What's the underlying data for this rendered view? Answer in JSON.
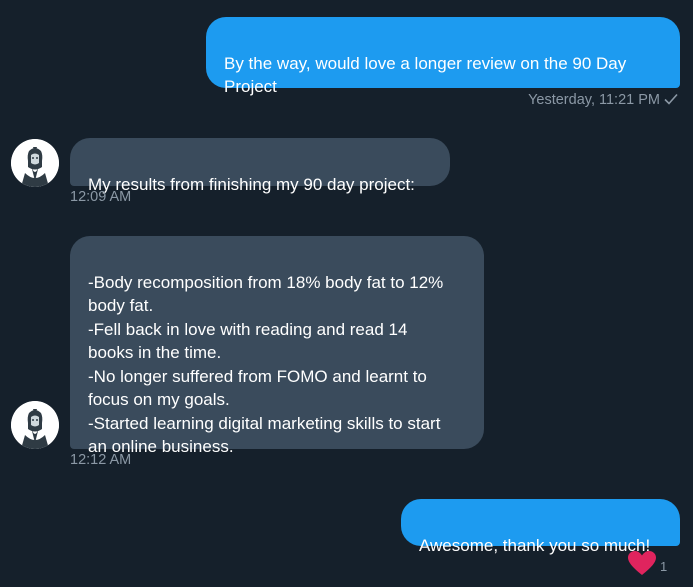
{
  "messages": [
    {
      "id": "m1",
      "direction": "outgoing",
      "text": "By the way, would love a longer review on the 90 Day\nProject",
      "time": "Yesterday, 11:21 PM",
      "status_icon": "check-icon"
    },
    {
      "id": "m2",
      "direction": "incoming",
      "text": "My results from finishing my 90 day project:",
      "time": "12:09 AM"
    },
    {
      "id": "m3",
      "direction": "incoming",
      "text": "-Body recomposition from 18% body fat to 12%\nbody fat.\n-Fell back in love with reading and read 14\nbooks in the time.\n-No longer suffered from FOMO and learnt to\nfocus on my goals.\n-Started learning digital marketing skills to start\nan online business.",
      "time": "12:12 AM"
    },
    {
      "id": "m4",
      "direction": "outgoing",
      "text": "Awesome, thank you so much!",
      "reaction": {
        "icon": "heart-icon",
        "count": "1"
      }
    }
  ],
  "contact": {
    "avatar_icon": "samurai-avatar-icon"
  },
  "colors": {
    "background": "#15202b",
    "outgoing_bubble": "#1d9bf0",
    "incoming_bubble": "#3a4b5c",
    "meta_text": "#8b98a5",
    "heart": "#f91880"
  }
}
